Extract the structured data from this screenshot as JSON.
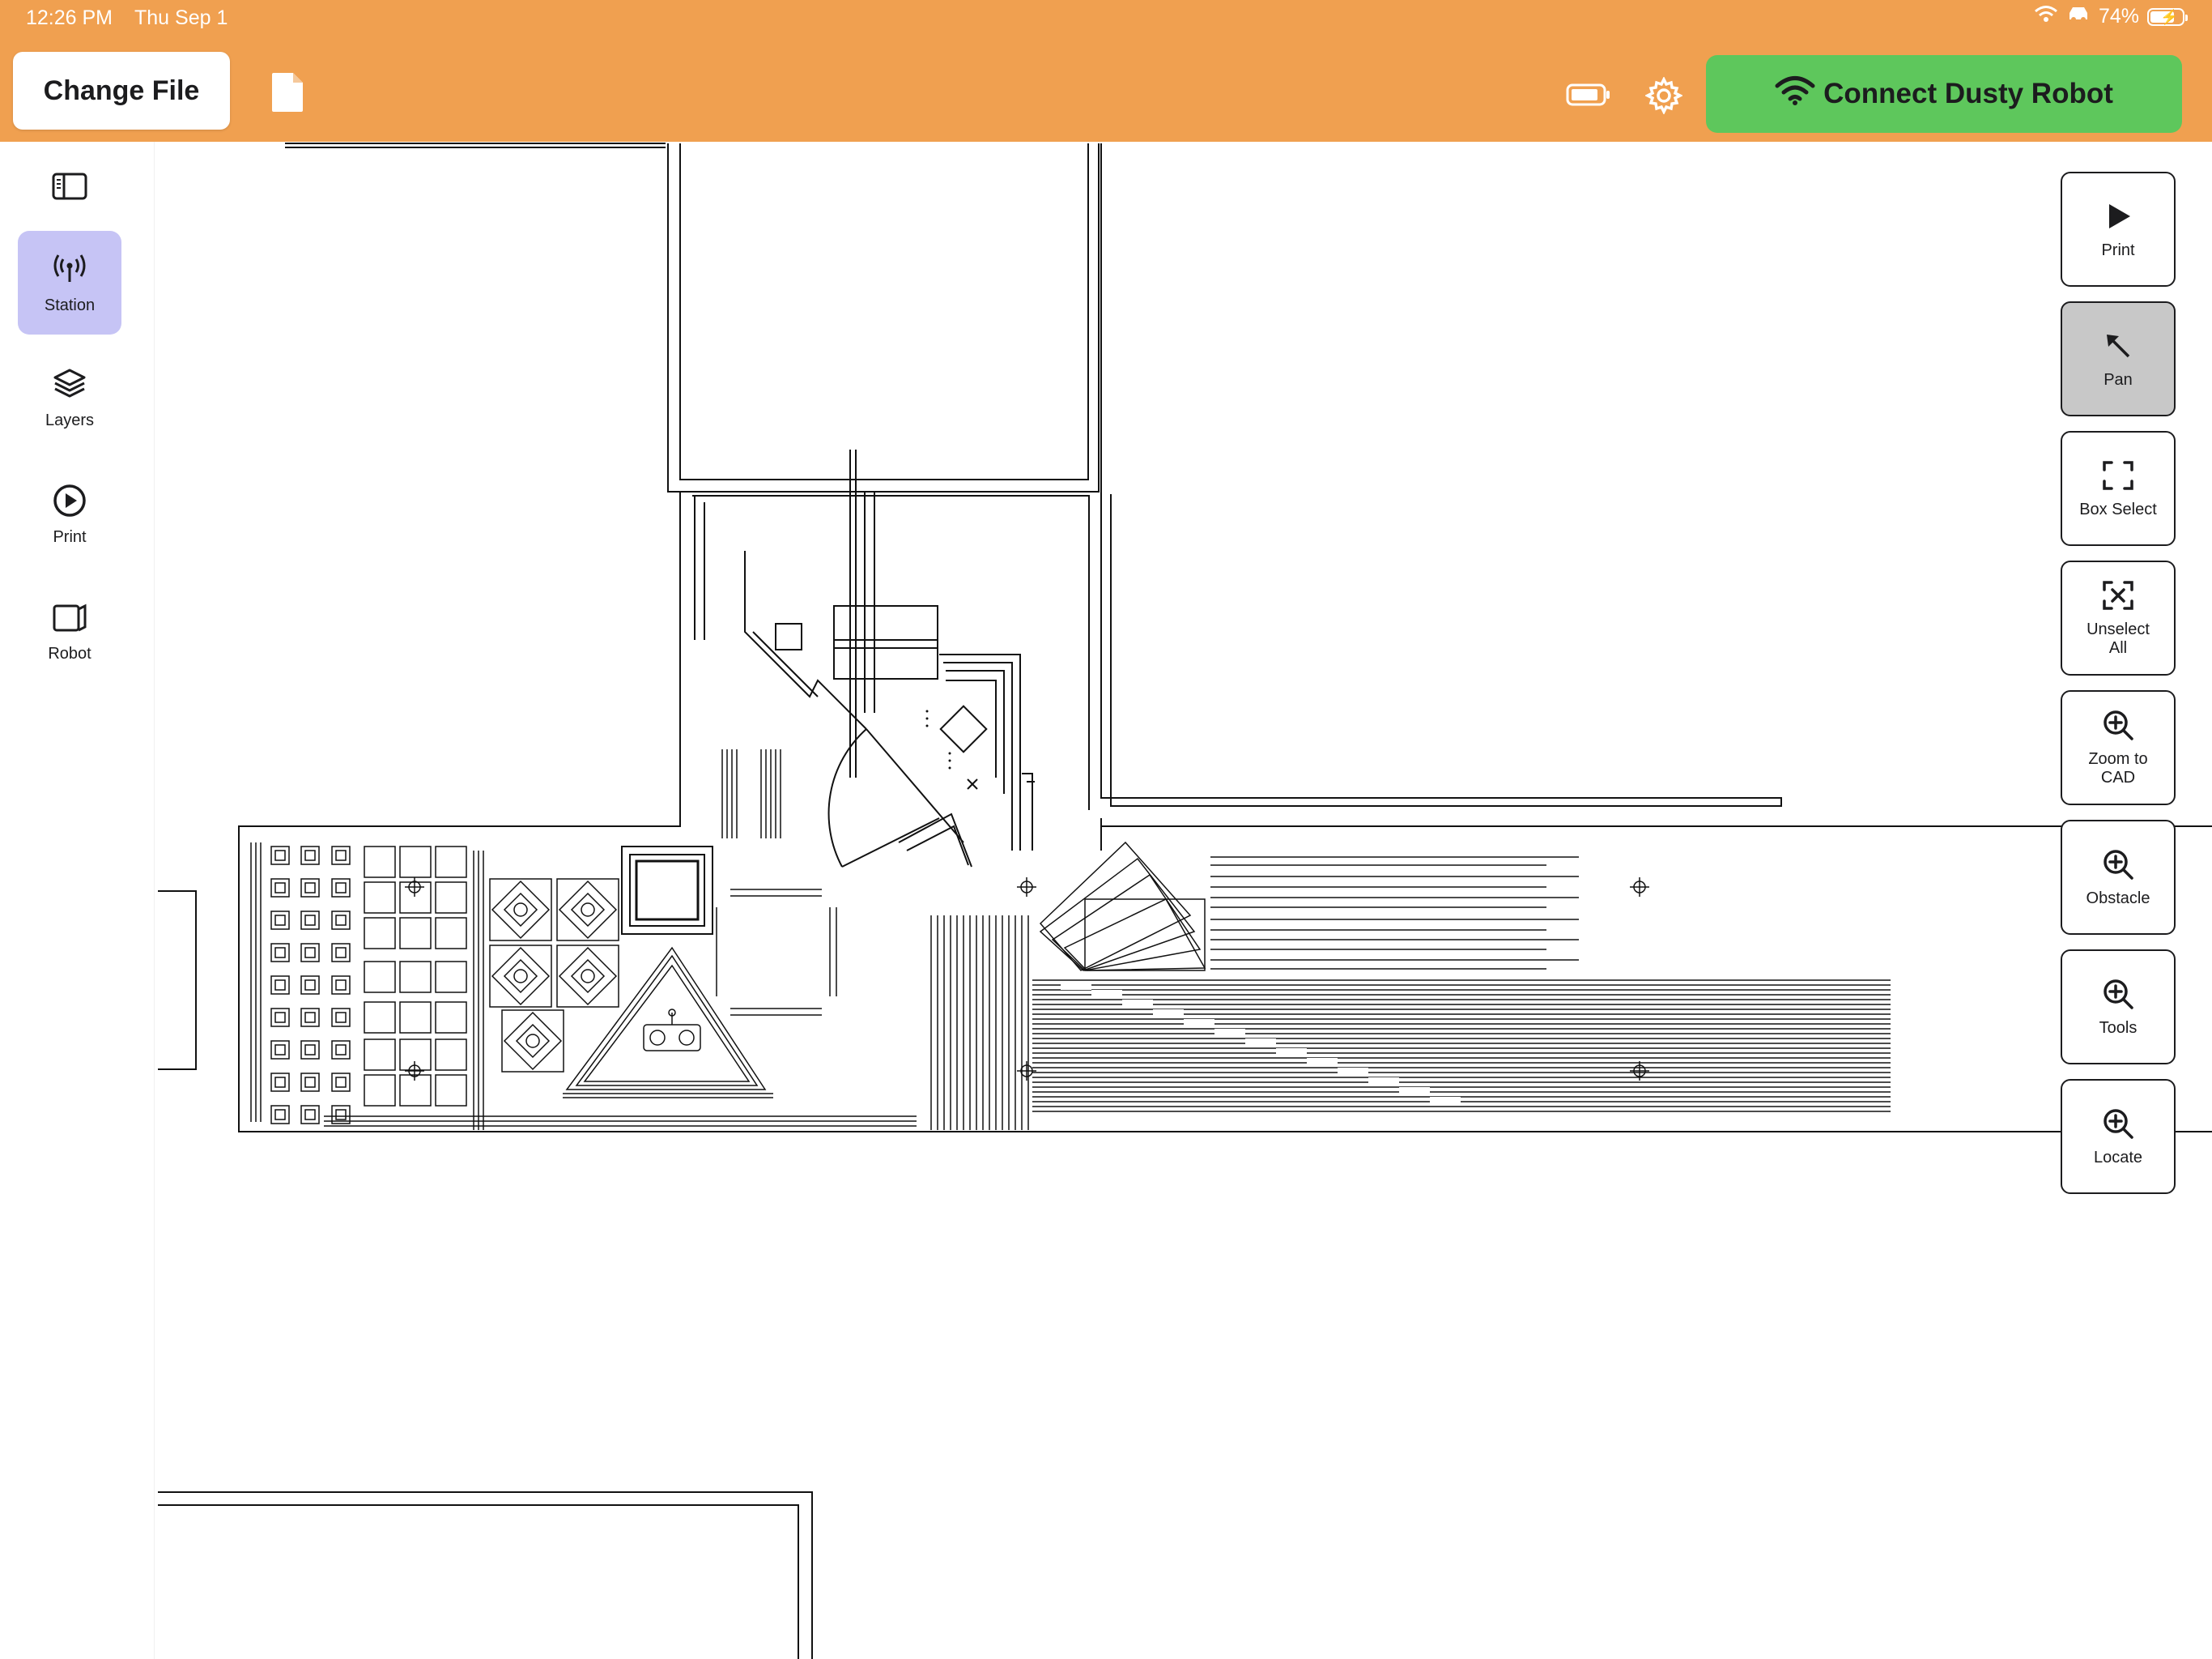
{
  "status_bar": {
    "time": "12:26 PM",
    "date": "Thu Sep 1",
    "battery_percent": "74%",
    "icons": [
      "wifi-icon",
      "car-icon",
      "battery-charging-icon"
    ]
  },
  "header": {
    "change_file_label": "Change File",
    "file_icon": "document-icon",
    "battery_icon": "battery-icon",
    "settings_icon": "gear-icon",
    "connect_label": "Connect Dusty Robot",
    "connect_icon": "wifi-icon",
    "accent_color": "#f0a050",
    "connect_color": "#5ec75c"
  },
  "sidebar": {
    "toggle_icon": "sidebar-toggle-icon",
    "items": [
      {
        "label": "Station",
        "icon": "antenna-icon",
        "active": true
      },
      {
        "label": "Layers",
        "icon": "layers-icon",
        "active": false
      },
      {
        "label": "Print",
        "icon": "play-circle-icon",
        "active": false
      },
      {
        "label": "Robot",
        "icon": "robot-icon",
        "active": false
      }
    ],
    "active_color": "#c6c4f5"
  },
  "tools": [
    {
      "label": "Print",
      "icon": "play-icon",
      "active": false
    },
    {
      "label": "Pan",
      "icon": "arrow-pointer-icon",
      "active": true
    },
    {
      "label": "Box Select",
      "icon": "box-select-icon",
      "active": false
    },
    {
      "label": "Unselect\nAll",
      "icon": "unselect-icon",
      "active": false
    },
    {
      "label": "Zoom to\nCAD",
      "icon": "zoom-icon",
      "active": false
    },
    {
      "label": "Obstacle",
      "icon": "zoom-icon",
      "active": false
    },
    {
      "label": "Tools",
      "icon": "zoom-icon",
      "active": false
    },
    {
      "label": "Locate",
      "icon": "zoom-icon",
      "active": false
    }
  ]
}
